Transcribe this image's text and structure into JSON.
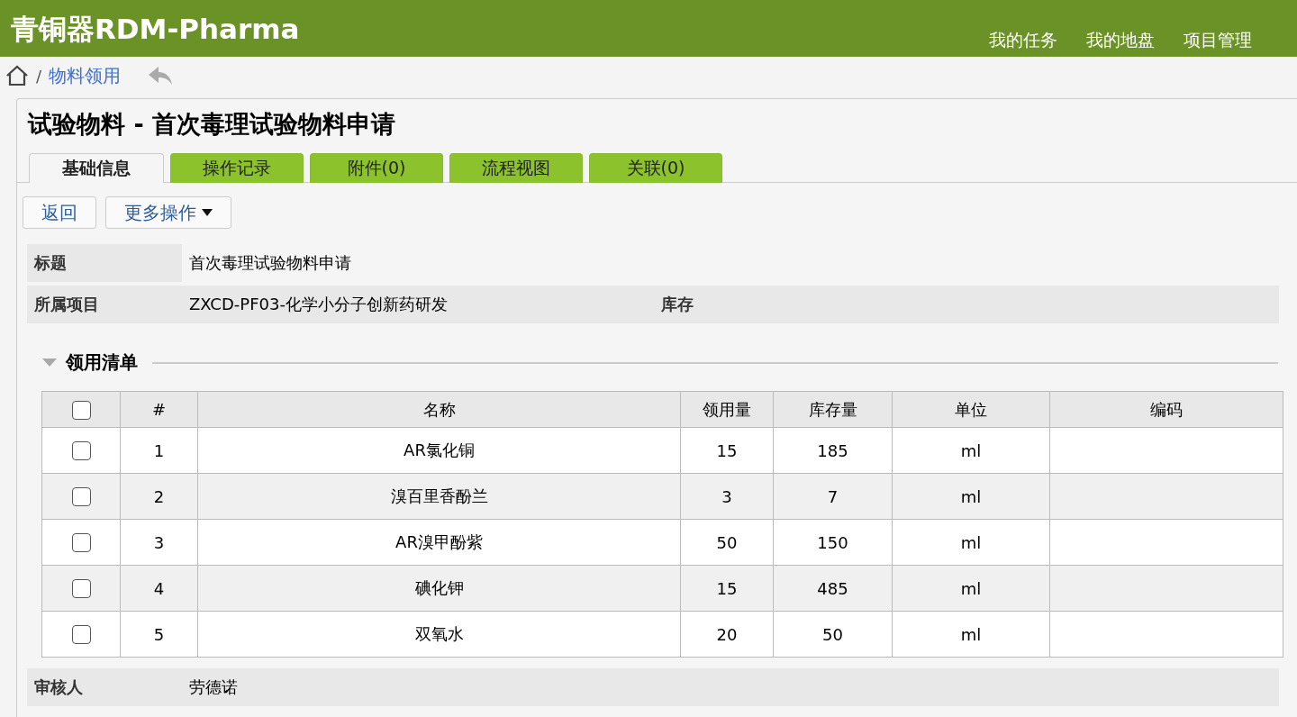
{
  "app": {
    "logo": "青铜器RDM-Pharma",
    "nav": [
      "我的任务",
      "我的地盘",
      "项目管理"
    ]
  },
  "breadcrumb": {
    "separator": "/",
    "link": "物料领用"
  },
  "page": {
    "title": "试验物料 - 首次毒理试验物料申请"
  },
  "tabs": [
    {
      "label": "基础信息",
      "selected": true
    },
    {
      "label": "操作记录",
      "selected": false
    },
    {
      "label": "附件(0)",
      "selected": false
    },
    {
      "label": "流程视图",
      "selected": false
    },
    {
      "label": "关联(0)",
      "selected": false
    }
  ],
  "actions": {
    "back": "返回",
    "more": "更多操作"
  },
  "fields": [
    {
      "label": "标题",
      "value": "首次毒理试验物料申请"
    },
    {
      "label": "所属项目",
      "value": "ZXCD-PF03-化学小分子创新药研发",
      "extra_label": "库存"
    }
  ],
  "section": {
    "title": "领用清单",
    "expanded": true
  },
  "table": {
    "header_checked": false,
    "columns": [
      "#",
      "名称",
      "领用量",
      "库存量",
      "单位",
      "编码"
    ],
    "rows": [
      {
        "checked": false,
        "cells": [
          "1",
          "AR氯化铜",
          "15",
          "185",
          "ml",
          ""
        ]
      },
      {
        "checked": false,
        "cells": [
          "2",
          "溴百里香酚兰",
          "3",
          "7",
          "ml",
          ""
        ]
      },
      {
        "checked": false,
        "cells": [
          "3",
          "AR溴甲酚紫",
          "50",
          "150",
          "ml",
          ""
        ]
      },
      {
        "checked": false,
        "cells": [
          "4",
          "碘化钾",
          "15",
          "485",
          "ml",
          ""
        ]
      },
      {
        "checked": false,
        "cells": [
          "5",
          "双氧水",
          "20",
          "50",
          "ml",
          ""
        ]
      }
    ]
  },
  "reviewer": {
    "label": "审核人",
    "value": "劳德诺"
  }
}
